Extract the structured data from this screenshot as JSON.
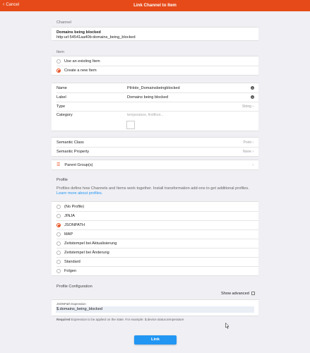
{
  "navbar": {
    "back_label": "Cancel",
    "title": "Link Channel to Item"
  },
  "channel": {
    "section_title": "Channel",
    "name": "Domains being blocked",
    "uid": "http:url:54541aa40b:domains_being_blocked"
  },
  "item": {
    "section_title": "Item",
    "options": [
      "Use an existing Item",
      "Create a new Item"
    ],
    "selected_index": 1
  },
  "item_details": {
    "name_label": "Name",
    "name_value": "PiHole_Domainsbeingblocked",
    "label_label": "Label",
    "label_value": "Domains being blocked",
    "type_label": "Type",
    "type_value": "String",
    "category_label": "Category",
    "category_placeholder": "temperature, firstfloor..."
  },
  "semantics": {
    "class_label": "Semantic Class",
    "class_value": "Point",
    "property_label": "Semantic Property",
    "property_value": "None"
  },
  "groups": {
    "label": "Parent Group(s)"
  },
  "profile": {
    "section_title": "Profile",
    "description": "Profiles define how Channels and Items work together. Install transformation add-ons to get additional profiles.",
    "learn_more": "Learn more about profiles.",
    "options": [
      "(No Profile)",
      "JINJA",
      "JSONPATH",
      "MAP",
      "Zeitstempel bei Aktualisierung",
      "Zeitstempel bei Änderung",
      "Standard",
      "Folgen"
    ],
    "selected_index": 2
  },
  "profile_config": {
    "section_title": "Profile Configuration",
    "show_advanced": "Show advanced",
    "field_label": "JSONPath Expression",
    "field_value": "$.domains_being_blocked",
    "required_label": "Required",
    "hint": "Expression to be applied on the state. For example: $.device.status.temperature"
  },
  "actions": {
    "link_label": "Link"
  },
  "colors": {
    "accent": "#e64a19",
    "primary": "#2196f3"
  },
  "icons": {
    "back": "chevron-left-icon",
    "clear": "clear-icon",
    "chevron": "chevron-right-icon",
    "group": "group-list-icon",
    "cursor": "mouse-pointer-icon"
  }
}
